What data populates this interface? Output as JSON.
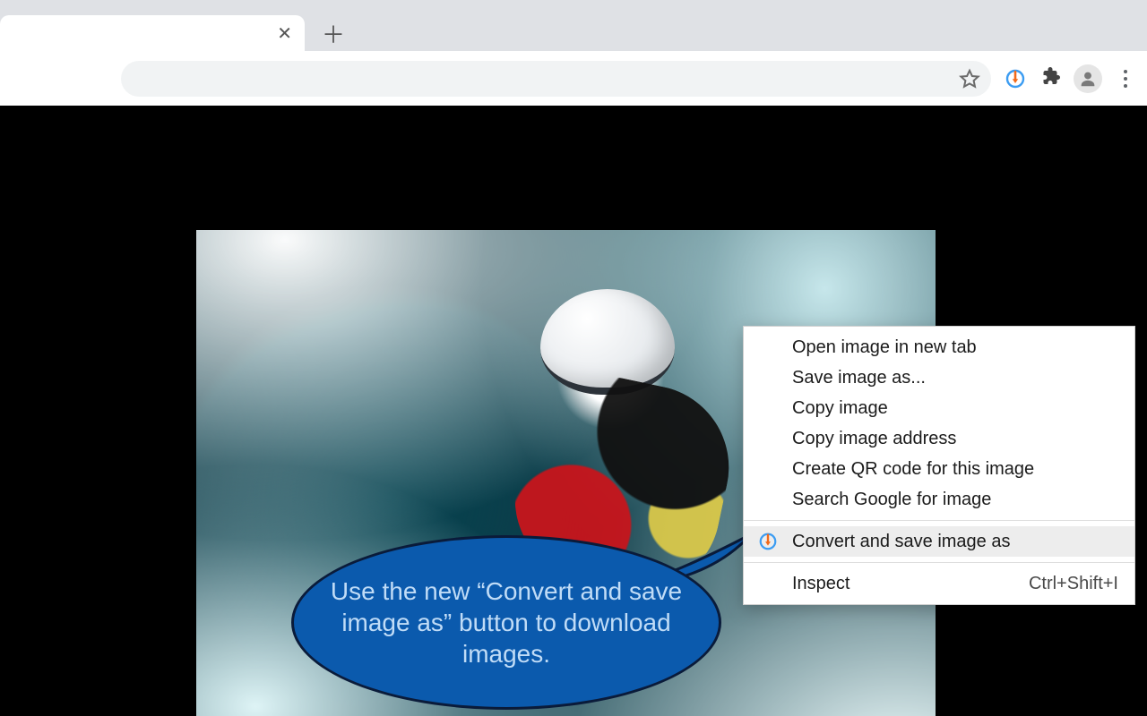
{
  "bubble_text": "Use the new “Convert and save image as” button to download images.",
  "context_menu": {
    "items": [
      {
        "label": "Open image in new tab"
      },
      {
        "label": "Save image as..."
      },
      {
        "label": "Copy image"
      },
      {
        "label": "Copy image address"
      },
      {
        "label": "Create QR code for this image"
      },
      {
        "label": "Search Google for image"
      }
    ],
    "highlighted": {
      "label": "Convert and save image as"
    },
    "inspect": {
      "label": "Inspect",
      "shortcut": "Ctrl+Shift+I"
    }
  }
}
